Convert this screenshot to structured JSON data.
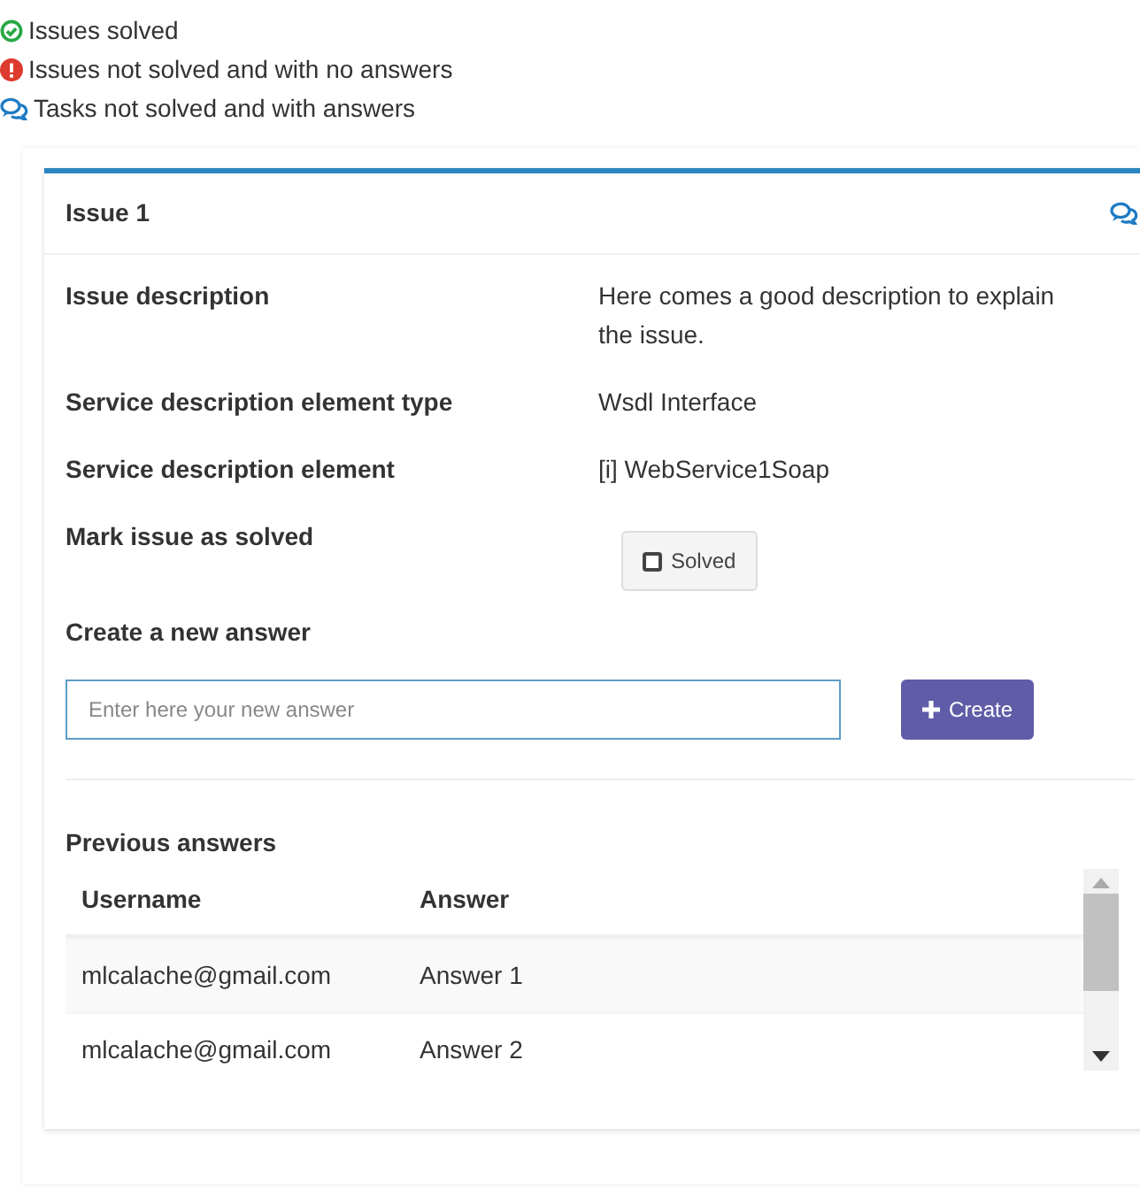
{
  "legend": [
    {
      "kind": "solved",
      "label": "Issues solved"
    },
    {
      "kind": "unanswered",
      "label": "Issues not solved and with no answers"
    },
    {
      "kind": "answered",
      "label": "Tasks not solved and with answers"
    }
  ],
  "issue": {
    "title": "Issue 1",
    "kind": "answered",
    "fields": [
      {
        "label": "Issue description",
        "value": "Here comes a good description to explain the issue."
      },
      {
        "label": "Service description element type",
        "value": "Wsdl Interface"
      },
      {
        "label": "Service description element",
        "value": "[i] WebService1Soap"
      }
    ],
    "mark_solved": {
      "label": "Mark issue as solved",
      "button": "Solved",
      "checked": false
    },
    "new_answer": {
      "label": "Create a new answer",
      "placeholder": "Enter here your new answer",
      "button": "Create"
    },
    "previous_answers": {
      "title": "Previous answers",
      "columns": [
        "Username",
        "Answer"
      ],
      "rows": [
        [
          "mlcalache@gmail.com",
          "Answer 1"
        ],
        [
          "mlcalache@gmail.com",
          "Answer 2"
        ]
      ]
    }
  }
}
